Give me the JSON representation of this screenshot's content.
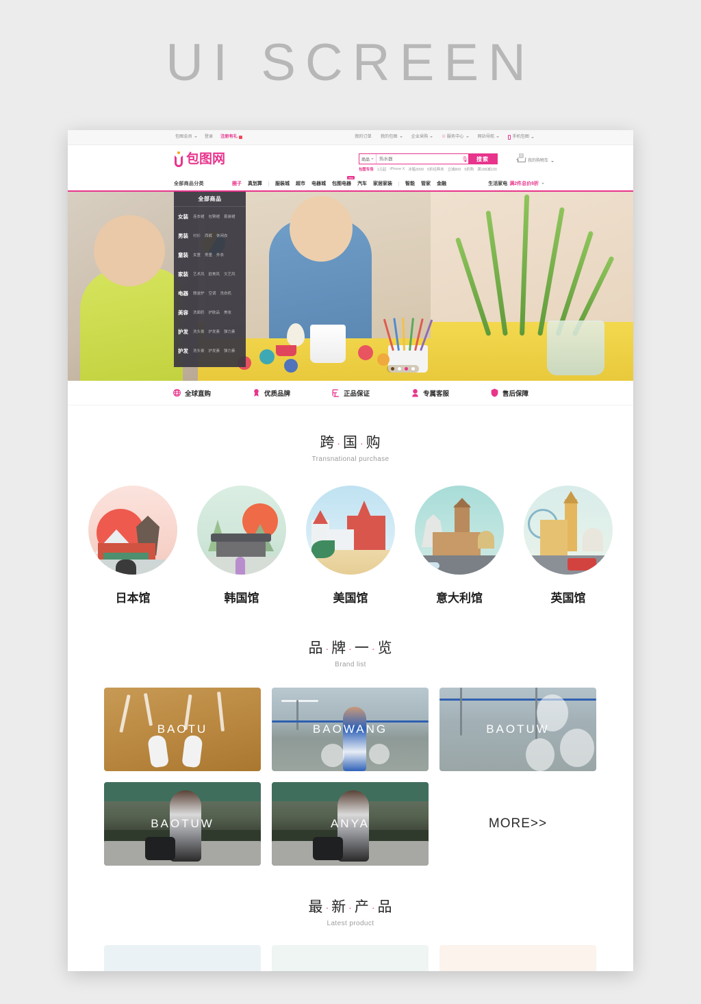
{
  "poster": {
    "title": "UI SCREEN"
  },
  "topbar": {
    "left": [
      {
        "label": "包图会员",
        "caret": true,
        "hot": false,
        "icon": ""
      },
      {
        "label": "登录",
        "caret": false,
        "hot": false,
        "icon": ""
      },
      {
        "label": "注册有礼",
        "caret": false,
        "hot": true,
        "icon": "gift-icon"
      }
    ],
    "right": [
      {
        "label": "我的订单",
        "caret": false,
        "icon": ""
      },
      {
        "label": "我的包图",
        "caret": true,
        "icon": ""
      },
      {
        "label": "企业采购",
        "caret": true,
        "icon": ""
      },
      {
        "label": "服务中心",
        "caret": true,
        "icon": "headset-icon"
      },
      {
        "label": "网站导航",
        "caret": true,
        "icon": ""
      },
      {
        "label": "手机包图",
        "caret": true,
        "icon": "phone-icon"
      }
    ]
  },
  "header": {
    "logo_text": "包图网",
    "search": {
      "category": "商品",
      "value": "",
      "placeholder": "热水器",
      "button_label": "搜索",
      "mic_icon": "microphone-icon",
      "hotwords_lead": "包图专场",
      "hotwords": [
        "1元起",
        "iPhone X",
        "冰箱3099",
        "5折经典本",
        "立减800",
        "5折购",
        "满188减100"
      ]
    },
    "cart": {
      "label": "我的购物车",
      "count": "0",
      "icon": "cart-icon"
    }
  },
  "nav": {
    "all_categories": "全部商品分类",
    "items": [
      {
        "label": "圈子",
        "accent": true,
        "badge": "",
        "sep_after": false
      },
      {
        "label": "真划算",
        "accent": false,
        "badge": "",
        "sep_after": true
      },
      {
        "label": "服装城",
        "accent": false,
        "badge": "",
        "sep_after": false
      },
      {
        "label": "超市",
        "accent": false,
        "badge": "",
        "sep_after": false
      },
      {
        "label": "电器城",
        "accent": false,
        "badge": "",
        "sep_after": false
      },
      {
        "label": "包图电器",
        "accent": false,
        "badge": "new",
        "sep_after": false
      },
      {
        "label": "汽车",
        "accent": false,
        "badge": "",
        "sep_after": false
      },
      {
        "label": "家居家装",
        "accent": false,
        "badge": "",
        "sep_after": true
      },
      {
        "label": "智能",
        "accent": false,
        "badge": "",
        "sep_after": false
      },
      {
        "label": "管家",
        "accent": false,
        "badge": "",
        "sep_after": false
      },
      {
        "label": "金融",
        "accent": false,
        "badge": "",
        "sep_after": false
      }
    ],
    "promo_title": "生活家电",
    "promo_text": "满2件总价8折"
  },
  "hero": {
    "flyout_title": "全部商品",
    "categories": [
      {
        "name": "女装",
        "subs": [
          "连衣裙",
          "包臀裙",
          "套装裙"
        ]
      },
      {
        "name": "男装",
        "subs": [
          "衬衫",
          "西裤",
          "休闲衣"
        ]
      },
      {
        "name": "童装",
        "subs": [
          "女童",
          "男童",
          "外衣"
        ]
      },
      {
        "name": "家装",
        "subs": [
          "艺术风",
          "欧美风",
          "文艺风"
        ]
      },
      {
        "name": "电器",
        "subs": [
          "微波炉",
          "空调",
          "洗衣机"
        ]
      },
      {
        "name": "美容",
        "subs": [
          "洗面奶",
          "护肤品",
          "美妆"
        ]
      },
      {
        "name": "护发",
        "subs": [
          "洗头膏",
          "护发素",
          "弹力素"
        ]
      },
      {
        "name": "护发",
        "subs": [
          "洗头膏",
          "护发素",
          "弹力素"
        ]
      }
    ],
    "carousel_dots": 4,
    "carousel_active_index": 2
  },
  "services": [
    {
      "label": "全球直购",
      "icon": "globe-icon"
    },
    {
      "label": "优质品牌",
      "icon": "medal-icon"
    },
    {
      "label": "正品保证",
      "icon": "authentic-icon"
    },
    {
      "label": "专属客服",
      "icon": "support-agent-icon"
    },
    {
      "label": "售后保障",
      "icon": "shield-icon"
    }
  ],
  "transnational": {
    "title_chars": [
      "跨",
      "国",
      "购"
    ],
    "subtitle": "Transnational purchase",
    "countries": [
      {
        "name": "日本馆",
        "theme": "japan"
      },
      {
        "name": "韩国馆",
        "theme": "korea"
      },
      {
        "name": "美国馆",
        "theme": "usa"
      },
      {
        "name": "意大利馆",
        "theme": "italy"
      },
      {
        "name": "英国馆",
        "theme": "uk"
      }
    ]
  },
  "brand_list": {
    "title_chars": [
      "品",
      "牌",
      "一",
      "览"
    ],
    "subtitle": "Brand list",
    "cards": [
      {
        "label": "BAOTU",
        "theme": "sand"
      },
      {
        "label": "BAOWANG",
        "theme": "court"
      },
      {
        "label": "BAOTUW",
        "theme": "balloon"
      },
      {
        "label": "BAOTUW",
        "theme": "fence"
      },
      {
        "label": "ANYA",
        "theme": "fence"
      }
    ],
    "more_label": "MORE>>"
  },
  "latest_product": {
    "title_chars": [
      "最",
      "新",
      "产",
      "品"
    ],
    "subtitle": "Latest product",
    "cards": [
      {
        "theme": "blue"
      },
      {
        "theme": "green"
      },
      {
        "theme": "cream"
      }
    ]
  },
  "colors": {
    "accent": "#e8348c",
    "page_bg": "#ececec",
    "dark_panel": "#3a3842",
    "text_dark": "#262626",
    "text_muted": "#9c9c9c"
  }
}
